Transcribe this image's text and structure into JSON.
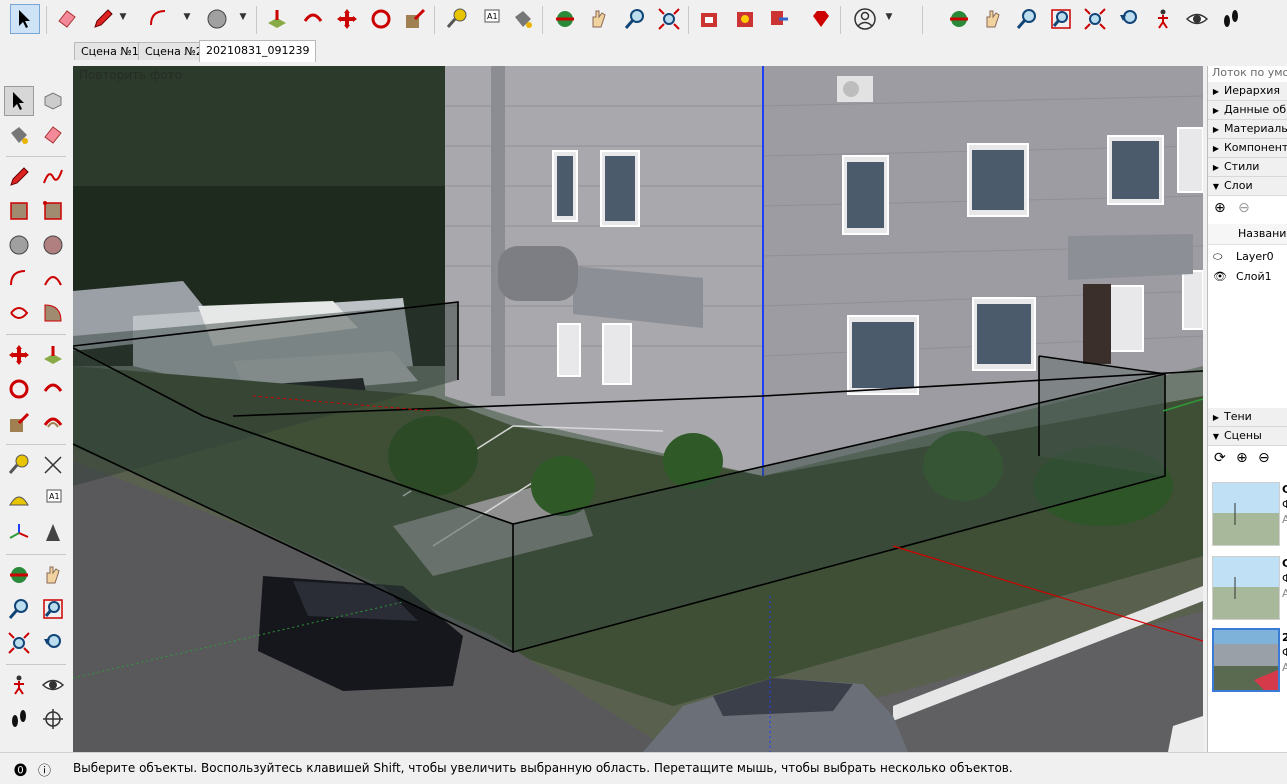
{
  "tabs": [
    "Сцена №1",
    "Сцена №2",
    "20210831_091239"
  ],
  "viewport": {
    "overlay_text": "Повторить фото"
  },
  "tray": {
    "header": "Лоток по умолчанию",
    "panels_top": [
      {
        "label": "Иерархия",
        "expanded": false
      },
      {
        "label": "Данные об",
        "expanded": false
      },
      {
        "label": "Материалы",
        "expanded": false
      },
      {
        "label": "Компоненты",
        "expanded": false
      },
      {
        "label": "Стили",
        "expanded": false
      },
      {
        "label": "Слои",
        "expanded": true
      }
    ],
    "layers": {
      "column_header": "Название",
      "items": [
        "Layer0",
        "Слой1"
      ]
    },
    "panels_bottom": [
      {
        "label": "Тени",
        "expanded": false
      },
      {
        "label": "Сцены",
        "expanded": true
      }
    ],
    "scene_thumbs": [
      {
        "line1": "С",
        "line2": "Ф",
        "line3": "А"
      },
      {
        "line1": "С",
        "line2": "Ф",
        "line3": "А"
      },
      {
        "line1": "2",
        "line2": "Ф",
        "line3": "А"
      }
    ]
  },
  "status": {
    "text": "Выберите объекты. Воспользуйтесь клавишей Shift, чтобы увеличить выбранную область. Перетащите мышь, чтобы выбрать несколько объектов."
  },
  "colors": {
    "accent": "#3a7bd5",
    "red_axis": "#d00000",
    "blue_axis": "#1f3fff",
    "green_axis": "#2f9a3a"
  }
}
